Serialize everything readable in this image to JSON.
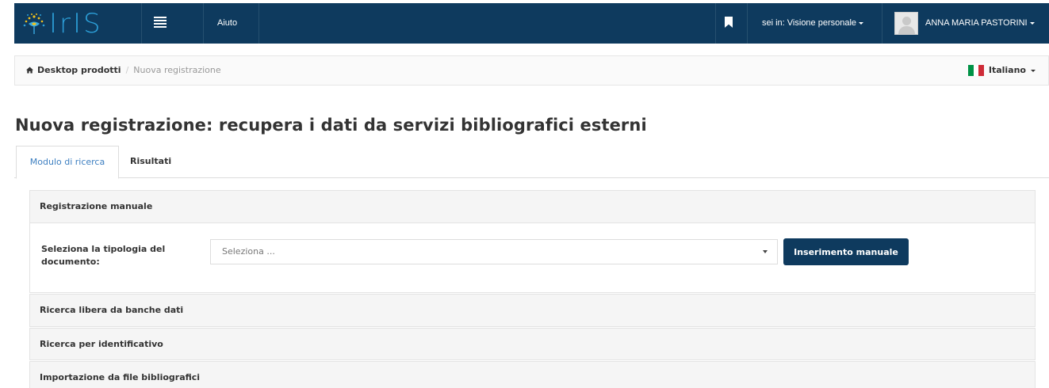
{
  "colors": {
    "navbar_bg": "#0e3a5e",
    "logo_blue": "#2c9fd8",
    "active_tab_text": "#3d7fc1",
    "button_bg": "#0e3a5e"
  },
  "navbar": {
    "logo_text": "IrIS",
    "menu_icon": "hamburger-menu-icon",
    "help_link": "Aiuto",
    "bookmark_icon": "bookmark-icon",
    "view_selector": "sei in: Visione personale",
    "user_name": "ANNA MARIA PASTORINI"
  },
  "breadcrumb": {
    "home_icon": "home-icon",
    "items": [
      "Desktop prodotti",
      "Nuova registrazione"
    ],
    "separator": "/"
  },
  "language": {
    "label": "Italiano",
    "flag": "italian-flag-icon"
  },
  "page": {
    "title": "Nuova registrazione: recupera i dati da servizi bibliografici esterni"
  },
  "tabs": [
    {
      "label": "Modulo di ricerca",
      "active": true
    },
    {
      "label": "Risultati",
      "active": false
    }
  ],
  "panels": {
    "manual": {
      "heading": "Registrazione manuale",
      "field_label": "Seleziona la tipologia del documento:",
      "select_placeholder": "Seleziona ...",
      "button_label": "Inserimento manuale"
    },
    "free_search": {
      "heading": "Ricerca libera da banche dati"
    },
    "id_search": {
      "heading": "Ricerca per identificativo"
    },
    "file_import": {
      "heading": "Importazione da file bibliografici"
    }
  }
}
